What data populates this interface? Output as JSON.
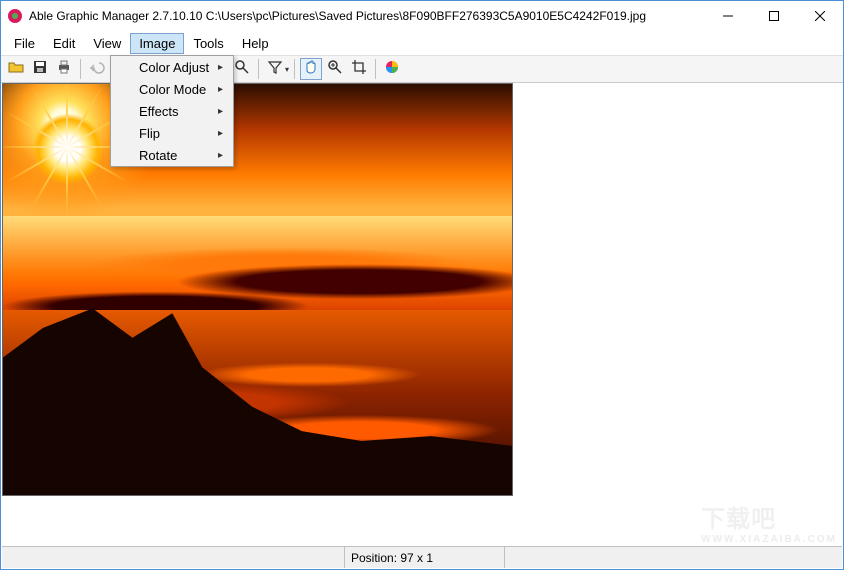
{
  "window": {
    "title": "Able Graphic Manager 2.7.10.10 C:\\Users\\pc\\Pictures\\Saved Pictures\\8F090BFF276393C5A9010E5C4242F019.jpg"
  },
  "menubar": {
    "items": [
      "File",
      "Edit",
      "View",
      "Image",
      "Tools",
      "Help"
    ],
    "open_index": 3
  },
  "dropdown": {
    "items": [
      {
        "label": "Color Adjust",
        "submenu": true
      },
      {
        "label": "Color Mode",
        "submenu": true
      },
      {
        "label": "Effects",
        "submenu": true
      },
      {
        "label": "Flip",
        "submenu": true
      },
      {
        "label": "Rotate",
        "submenu": true
      }
    ]
  },
  "toolbar": {
    "buttons": [
      {
        "name": "open-icon"
      },
      {
        "name": "save-icon"
      },
      {
        "name": "print-icon"
      },
      {
        "sep": true
      },
      {
        "name": "undo-icon",
        "disabled": true
      },
      {
        "sep": true
      },
      {
        "name": "zoom-in-icon",
        "hidden_by_menu": true
      },
      {
        "name": "zoom-tool-icon"
      },
      {
        "sep": true
      },
      {
        "name": "filter-icon",
        "dropdown": true
      },
      {
        "sep": true
      },
      {
        "name": "hand-icon",
        "active": true
      },
      {
        "name": "magnifier-plus-icon"
      },
      {
        "name": "crop-icon"
      },
      {
        "sep": true
      },
      {
        "name": "color-wheel-icon"
      }
    ]
  },
  "status": {
    "position_label": "Position:",
    "position_value": "97 x 1"
  },
  "watermark": {
    "big": "下载吧",
    "small": "WWW.XIAZAIBA.COM"
  }
}
